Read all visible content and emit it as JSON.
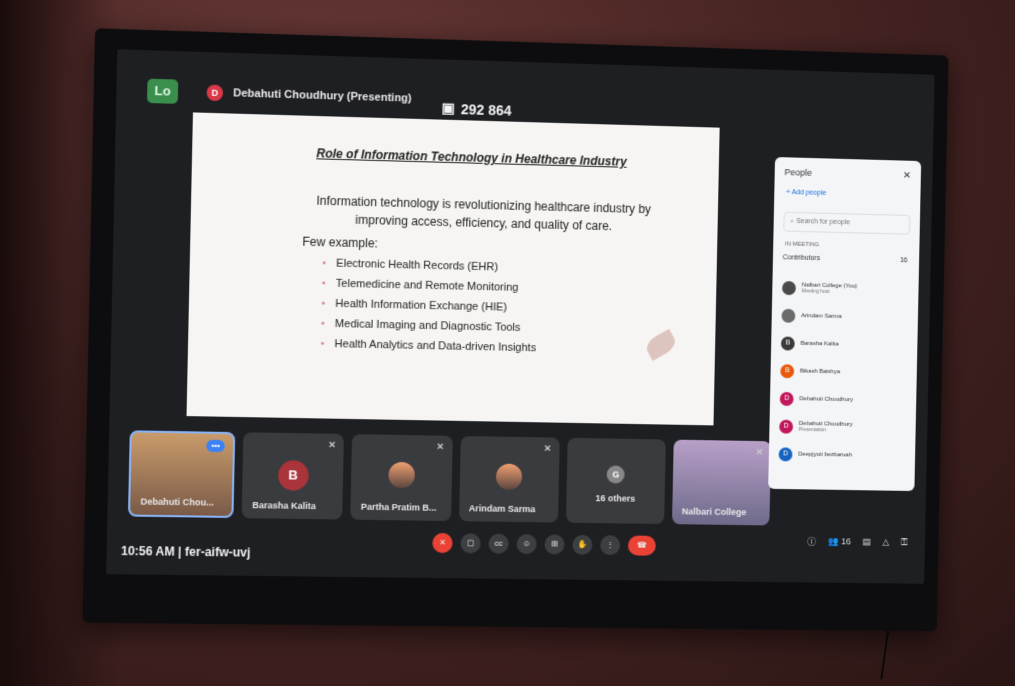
{
  "meeting": {
    "presenter": "Debahuti Choudhury (Presenting)",
    "presenter_initial": "D",
    "participant_count": "292 864",
    "time": "10:56 AM",
    "separator": "|",
    "meeting_code": "fer-aifw-uvj",
    "host_badge": "Lo"
  },
  "slide": {
    "title": "Role of Information Technology in Healthcare Industry",
    "intro": "Information technology is revolutionizing healthcare industry by improving access, efficiency, and quality of care.",
    "few_example": "Few example:",
    "items": [
      "Electronic Health Records (EHR)",
      "Telemedicine and Remote Monitoring",
      "Health Information Exchange (HIE)",
      "Medical Imaging and Diagnostic Tools",
      "Health Analytics and Data-driven Insights"
    ]
  },
  "tiles": [
    {
      "name": "Debahuti Chou..."
    },
    {
      "name": "Barasha Kalita",
      "initial": "B"
    },
    {
      "name": "Partha Pratim B..."
    },
    {
      "name": "Arindam Sarma"
    },
    {
      "name": "16 others",
      "initial": "G"
    },
    {
      "name": "Nalbari College"
    }
  ],
  "people_panel": {
    "title": "People",
    "add_people": "Add people",
    "search_placeholder": "Search for people",
    "in_meeting": "IN MEETING",
    "contributors_label": "Contributors",
    "contributors_count": "16",
    "participants": [
      {
        "name": "Nalbari College (You)",
        "meta": "Meeting host",
        "initial": "",
        "color": "#4a4a4a"
      },
      {
        "name": "Arindam Sarma",
        "initial": "",
        "color": "#6b6b6b"
      },
      {
        "name": "Barasha Kalita",
        "initial": "B",
        "color": "#3a3a3a"
      },
      {
        "name": "Bikash Baishya",
        "initial": "B",
        "color": "#e8590c"
      },
      {
        "name": "Debahuti Choudhury",
        "initial": "D",
        "color": "#c2185b"
      },
      {
        "name": "Debahuti Choudhury",
        "meta": "Presentation",
        "initial": "D",
        "color": "#c2185b"
      },
      {
        "name": "Deepjyoti bezbaruah",
        "initial": "D",
        "color": "#1565c0"
      }
    ]
  },
  "controls": {
    "people_count": "16"
  }
}
